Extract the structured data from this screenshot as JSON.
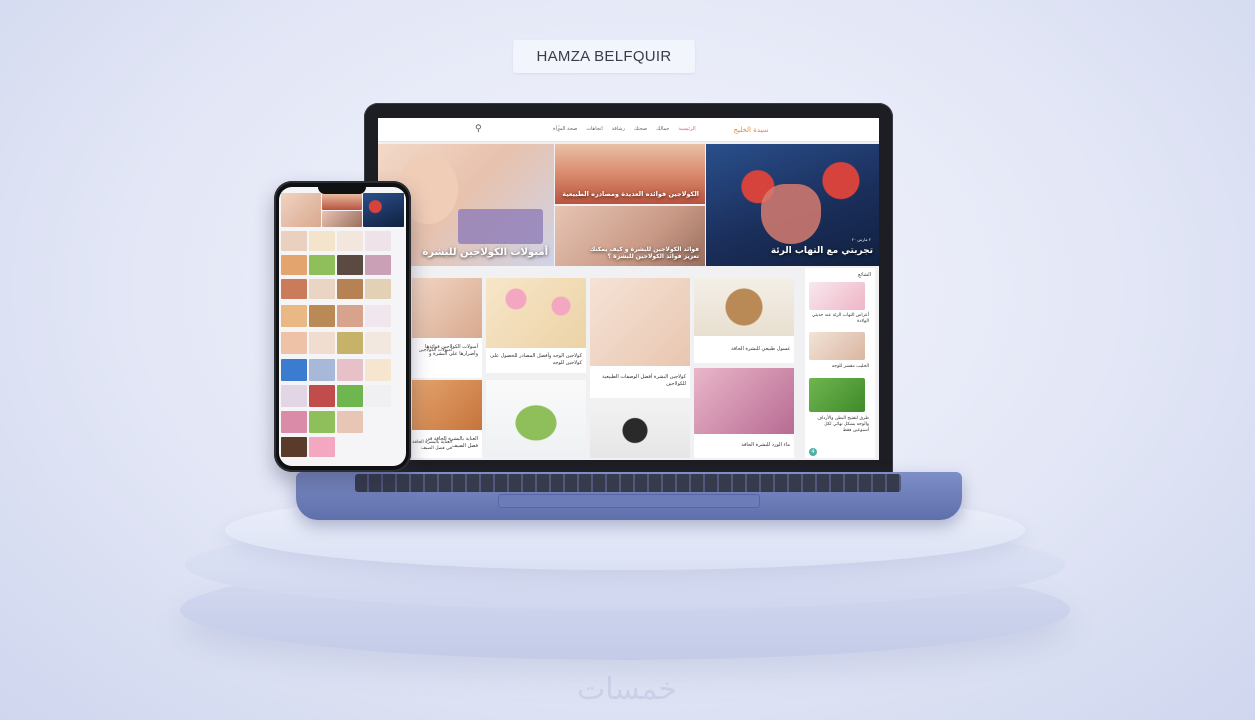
{
  "brand_tag": "HAMZA BELFQUIR",
  "site": {
    "logo_text": "سيدة الخليج",
    "nav_items": [
      "الرئيسية",
      "جمالك",
      "صحتك",
      "رشاقة",
      "اتجاهات",
      "صحة المرأة"
    ],
    "active_nav": "الرئيسية"
  },
  "hero": {
    "main_caption": "تجربتي مع التهاب الرئة",
    "main_meta": "٢ مارس ٢٠",
    "top_caption": "الكولاجين فوائده العديدة ومصادره الطبيعية",
    "bottom_caption": "فوائد الكولاجين للبشرة و كيف يمكنك تعزيز فوائد الكولاجين للبشرة ؟",
    "left_caption": "أمبولات الكولاجين للبشرة"
  },
  "cards": [
    {
      "label": "غسول طبيعي للبشرة الجافة"
    },
    {
      "label": "كولاجين البشرة أفضل الوصفات الطبيعية للكولاجين"
    },
    {
      "label": "كولاجين الوجه وأفضل المصادر للحصول على كولاجين للوجه"
    },
    {
      "label": "أمبولات الكولاجين فوائدها وأضرارها على البشرة و"
    },
    {
      "label": "ماء الورد للبشرة الجافة"
    },
    {
      "label": "العناية بالبشرة الجافة في فصل الصيف"
    }
  ],
  "sidebar": {
    "heading": "الشائع",
    "items": [
      {
        "num": "1",
        "label": "أعراض التهاب الرئة عند حديثي الولادة"
      },
      {
        "num": "2",
        "label": "الحليب مقشر للوجه"
      },
      {
        "num": "3",
        "label": "طرق لتفتيح البطن والأرداف والوجه بشكل نهائي لكل أسبوعين فقط"
      },
      {
        "num": "4",
        "label": ""
      }
    ]
  },
  "phone": {
    "caption_1": "أمبولات الكولاجين",
    "caption_2": "العناية بالبشرة الجافة في فصل الصيف"
  },
  "watermark": "خمسات",
  "colors": {
    "accent_pink": "#e45b89",
    "logo_orange": "#e98a3b",
    "teal": "#4bb2a6",
    "laptop_base": "#6f7fbd"
  }
}
